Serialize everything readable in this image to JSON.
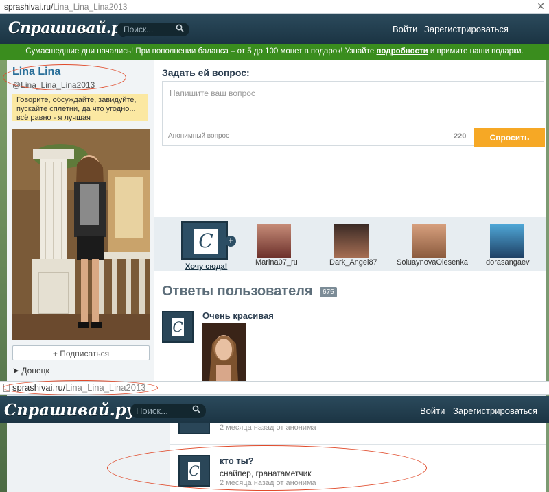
{
  "url1": {
    "domain": "sprashivai.ru/",
    "path": "Lina_Lina_Lina2013"
  },
  "url2": {
    "domain": "sprashivai.ru/",
    "path": "Lina_Lina_Lina2013"
  },
  "header": {
    "logo": "Спрашивай.ру",
    "search_placeholder": "Поиск...",
    "login": "Войти",
    "register": "Зарегистрироваться"
  },
  "banner": {
    "text_before": "Сумасшедшие дни начались! При пополнении баланса – от 5 до 100 монет в подарок! Узнайте ",
    "link": "подробности",
    "text_after": " и примите наши подарки."
  },
  "profile": {
    "name": "Lina Lina",
    "username": "@Lina_Lina_Lina2013",
    "status": "Говорите, обсуждайте, завидуйте, пускайте сплетни, да что угодно... всё равно - я лучшая",
    "subscribe": "+ Подписаться",
    "city": "Донецк"
  },
  "ask": {
    "title": "Задать ей вопрос:",
    "placeholder": "Напишите ваш вопрос",
    "anon": "Анонимный вопрос",
    "count": "220",
    "button": "Спросить"
  },
  "strip": {
    "want_label": "Хочу сюда!",
    "users": [
      "Marina07_ru",
      "Dark_Angel87",
      "SoluaynovaOlesenka",
      "dorasangaev"
    ]
  },
  "answers": {
    "title": "Ответы пользователя",
    "count": "675",
    "q1": "Очень красивая",
    "meta1": "2 месяца назад от анонима",
    "q2": "кто ты?",
    "a2": "снайпер, гранатаметчик",
    "meta2": "2 месяца назад от анонима"
  },
  "colors": {
    "accent": "#f6a825",
    "header": "#1b3443",
    "banner": "#3a8d1e",
    "highlight": "#e04a2a"
  }
}
